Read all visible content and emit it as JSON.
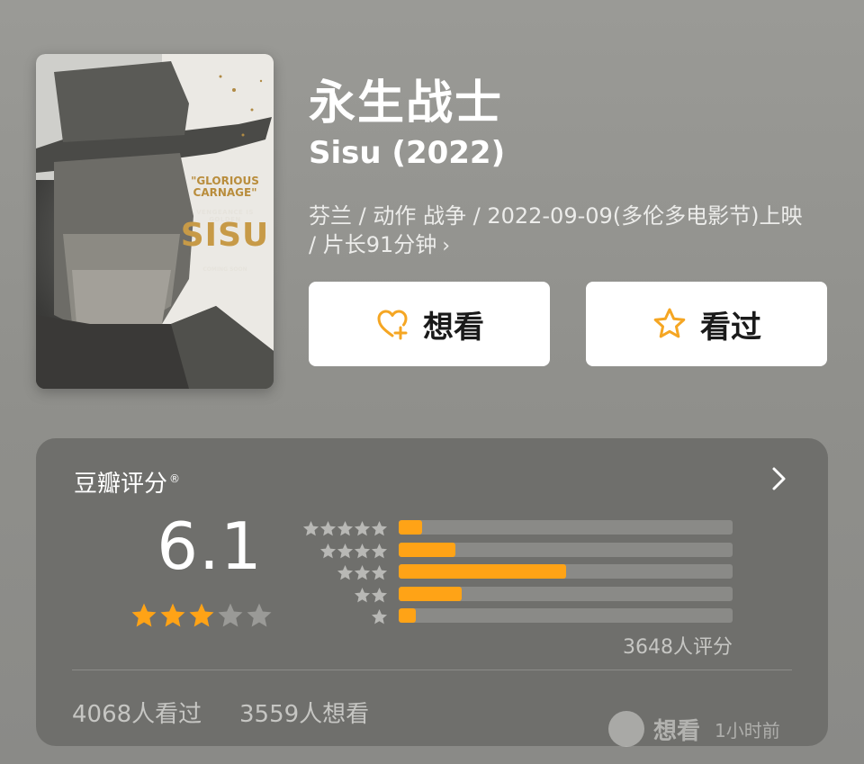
{
  "movie": {
    "title_cn": "永生战士",
    "title_en": "Sisu (2022)",
    "meta": "芬兰 / 动作 战争 / 2022-09-09(多伦多电影节)上映 / 片长91分钟",
    "meta_chevron": "›"
  },
  "poster": {
    "quote": "\"GLORIOUS CARNAGE\"",
    "tagline": "VENGEANCE IS GOLDEN",
    "title": "SISU",
    "coming_soon": "COMING SOON"
  },
  "actions": {
    "want_label": "想看",
    "seen_label": "看过"
  },
  "rating": {
    "section_title": "豆瓣评分",
    "registered_mark": "®",
    "score": "6.1",
    "stars_filled": 3,
    "stars_total": 5,
    "distribution": [
      {
        "stars": 5,
        "fraction": 0.07
      },
      {
        "stars": 4,
        "fraction": 0.17
      },
      {
        "stars": 3,
        "fraction": 0.5
      },
      {
        "stars": 2,
        "fraction": 0.19
      },
      {
        "stars": 1,
        "fraction": 0.05
      }
    ],
    "count_text": "3648人评分",
    "seen_text": "4068人看过",
    "want_text": "3559人想看"
  },
  "watermark": {
    "text": "想看",
    "time": "1小时前"
  },
  "colors": {
    "accent": "#ffa316",
    "star_empty": "#9a9a97",
    "card_bg": "#6f6f6c"
  }
}
